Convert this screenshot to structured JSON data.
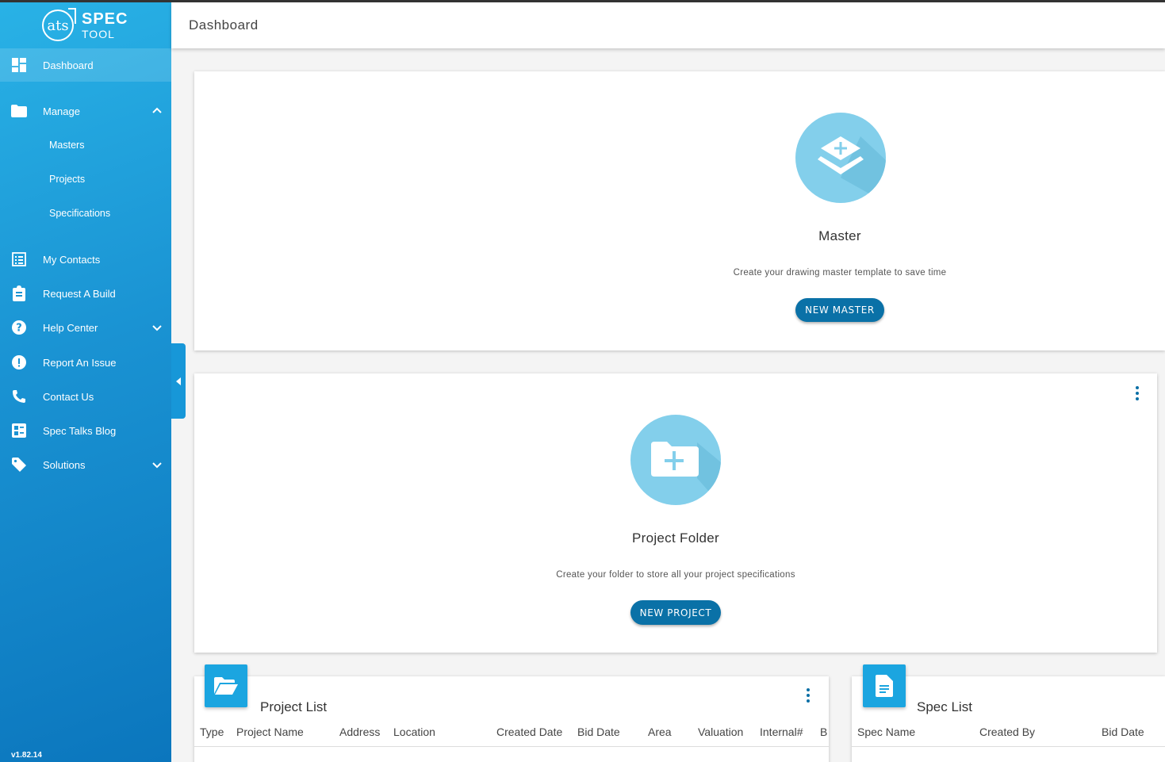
{
  "brand": {
    "logo_text": "ats",
    "name_line1": "SPEC",
    "name_line2": "TOOL"
  },
  "header": {
    "title": "Dashboard"
  },
  "sidebar": {
    "items": [
      {
        "label": "Dashboard",
        "icon": "dashboard-icon"
      },
      {
        "label": "Manage",
        "icon": "folder-icon"
      },
      {
        "label": "My Contacts",
        "icon": "contacts-list-icon"
      },
      {
        "label": "Request A Build",
        "icon": "clipboard-icon"
      },
      {
        "label": "Help Center",
        "icon": "help-circle-icon"
      },
      {
        "label": "Report An Issue",
        "icon": "alert-circle-icon"
      },
      {
        "label": "Contact Us",
        "icon": "phone-icon"
      },
      {
        "label": "Spec Talks Blog",
        "icon": "blog-icon"
      },
      {
        "label": "Solutions",
        "icon": "tag-icon"
      }
    ],
    "manage_sub": [
      "Masters",
      "Projects",
      "Specifications"
    ],
    "version": "v1.82.14"
  },
  "master_card": {
    "title": "Master",
    "description": "Create your drawing master template to save time",
    "button": "NEW MASTER"
  },
  "project_card": {
    "title": "Project Folder",
    "description": "Create your folder to store all your project specifications",
    "button": "NEW PROJECT"
  },
  "project_list": {
    "title": "Project List",
    "columns": [
      "Type",
      "Project Name",
      "Address",
      "Location",
      "Created Date",
      "Bid Date",
      "Area",
      "Valuation",
      "Internal#",
      "B"
    ]
  },
  "spec_list": {
    "title": "Spec List",
    "columns": [
      "Spec Name",
      "Created By",
      "Bid Date"
    ]
  },
  "colors": {
    "sidebar_top": "#29b2e6",
    "sidebar_bottom": "#0b76bd",
    "button": "#0a71a7",
    "icon_circle": "#83cfeb"
  }
}
